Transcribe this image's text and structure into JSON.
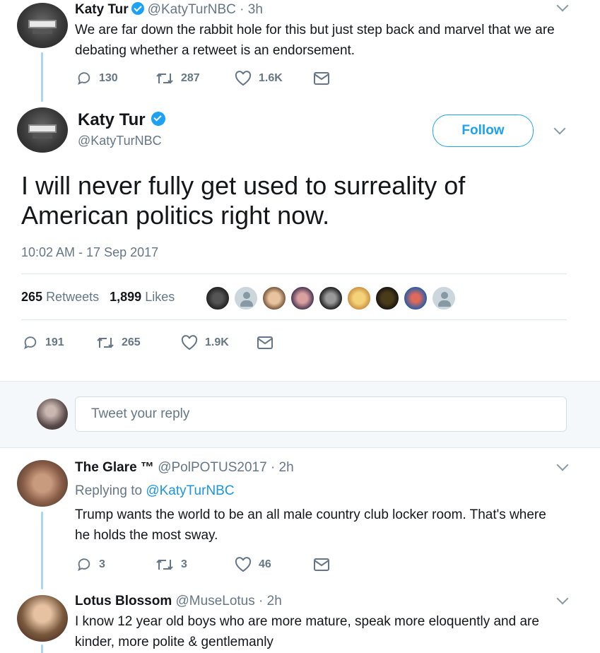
{
  "prev_tweet": {
    "name": "Katy Tur",
    "handle": "@KatyTurNBC",
    "time": "· 3h",
    "text_lines": [
      "We are far down the rabbit hole for this but just step back and marvel that we are",
      "debating whether a retweet is an endorsement."
    ],
    "replies": "130",
    "retweets": "287",
    "likes": "1.6K"
  },
  "main_tweet": {
    "name": "Katy Tur",
    "handle": "@KatyTurNBC",
    "follow_label": "Follow",
    "text_lines": [
      "I will never fully get used to surreality of",
      "American politics right now."
    ],
    "timestamp": "10:02 AM - 17 Sep 2017",
    "retweet_count": "265",
    "retweet_label": "Retweets",
    "like_count": "1,899",
    "like_label": "Likes",
    "replies": "191",
    "retweets": "265",
    "likes": "1.9K"
  },
  "reply_box": {
    "placeholder": "Tweet your reply"
  },
  "replies": [
    {
      "name": "The Glare ™",
      "handle": "@PolPOTUS2017",
      "time": "· 2h",
      "replying_prefix": "Replying to",
      "replying_to": "@KatyTurNBC",
      "text_lines": [
        "Trump wants the world to be an all male country club locker room.  That's where",
        "he holds the most sway."
      ],
      "replies": "3",
      "retweets": "3",
      "likes": "46"
    },
    {
      "name": "Lotus Blossom",
      "handle": "@MuseLotus",
      "time": "· 2h",
      "text_lines": [
        "I know 12 year old boys who are more mature, speak more eloquently and are",
        "kinder, more polite & gentlemanly"
      ]
    }
  ],
  "colors": {
    "accent": "#1da1f2",
    "muted": "#657786",
    "text": "#14171a",
    "thread_line": "#a9d6f2"
  },
  "icons": [
    "reply-icon",
    "retweet-icon",
    "like-icon",
    "dm-icon",
    "verified-icon",
    "chevron-down-icon"
  ]
}
